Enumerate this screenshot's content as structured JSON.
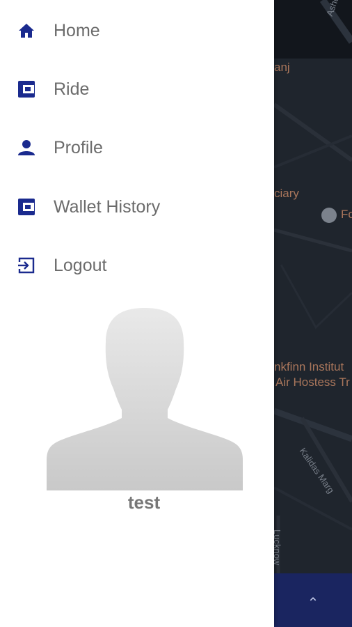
{
  "menu": {
    "items": [
      {
        "label": "Home",
        "icon": "home-icon"
      },
      {
        "label": "Ride",
        "icon": "wallet-icon"
      },
      {
        "label": "Profile",
        "icon": "person-icon"
      },
      {
        "label": "Wallet History",
        "icon": "wallet-icon"
      },
      {
        "label": "Logout",
        "icon": "logout-icon"
      }
    ]
  },
  "profile": {
    "username": "test"
  },
  "map": {
    "labels": [
      "anj",
      "ciary",
      "Fo",
      "nkfinn Institut",
      "Air Hostess Tr",
      "Ashok Marg",
      "Kalidas Marg",
      "Lucknow"
    ]
  },
  "colors": {
    "accent": "#1a2a8e",
    "text": "#6b6b6b",
    "bottom_bar": "#1a2560"
  }
}
